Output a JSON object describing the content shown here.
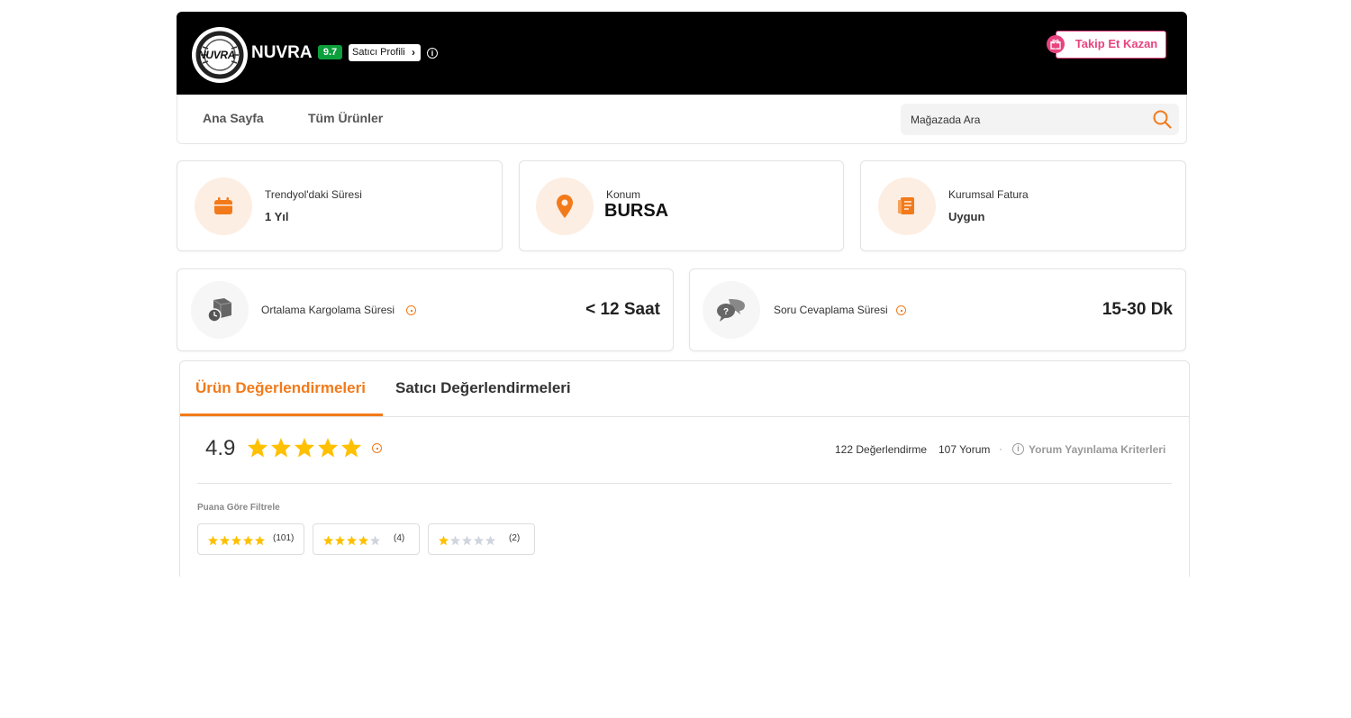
{
  "header": {
    "logo_text": "NUVRA",
    "store_name": "NUVRA",
    "score": "9.7",
    "seller_profile_label": "Satıcı Profili",
    "follow_label": "Takip Et Kazan"
  },
  "nav": {
    "home_label": "Ana Sayfa",
    "all_products_label": "Tüm Ürünler",
    "search_placeholder": "Mağazada Ara"
  },
  "info_cards": [
    {
      "label": "Trendyol'daki Süresi",
      "value": "1 Yıl",
      "icon": "calendar-icon"
    },
    {
      "label": "Konum",
      "value": "BURSA",
      "icon": "location-pin-icon"
    },
    {
      "label": "Kurumsal Fatura",
      "value": "Uygun",
      "icon": "invoice-icon"
    }
  ],
  "metric_cards": [
    {
      "label": "Ortalama Kargolama Süresi",
      "value": "< 12 Saat",
      "icon": "cargo-box-icon"
    },
    {
      "label": "Soru Cevaplama Süresi",
      "value": "15-30 Dk",
      "icon": "chat-bubbles-icon"
    }
  ],
  "reviews": {
    "tabs": [
      {
        "label": "Ürün Değerlendirmeleri",
        "active": true
      },
      {
        "label": "Satıcı Değerlendirmeleri",
        "active": false
      }
    ],
    "rating": "4.9",
    "rating_stars": 5,
    "ratings_count_label": "122 Değerlendirme",
    "comments_count_label": "107 Yorum",
    "separator": "·",
    "criteria_label": "Yorum Yayınlama Kriterleri",
    "filter_title": "Puana Göre Filtrele",
    "filters": [
      {
        "stars": 5,
        "count": "(101)"
      },
      {
        "stars": 4,
        "count": "(4)"
      },
      {
        "stars": 1,
        "count": "(2)"
      }
    ]
  },
  "colors": {
    "accent": "#f27a1a",
    "star": "#ffc000",
    "star_empty": "#d0d5de",
    "follow": "#e8437f",
    "score_badge": "#0c9f3c"
  }
}
